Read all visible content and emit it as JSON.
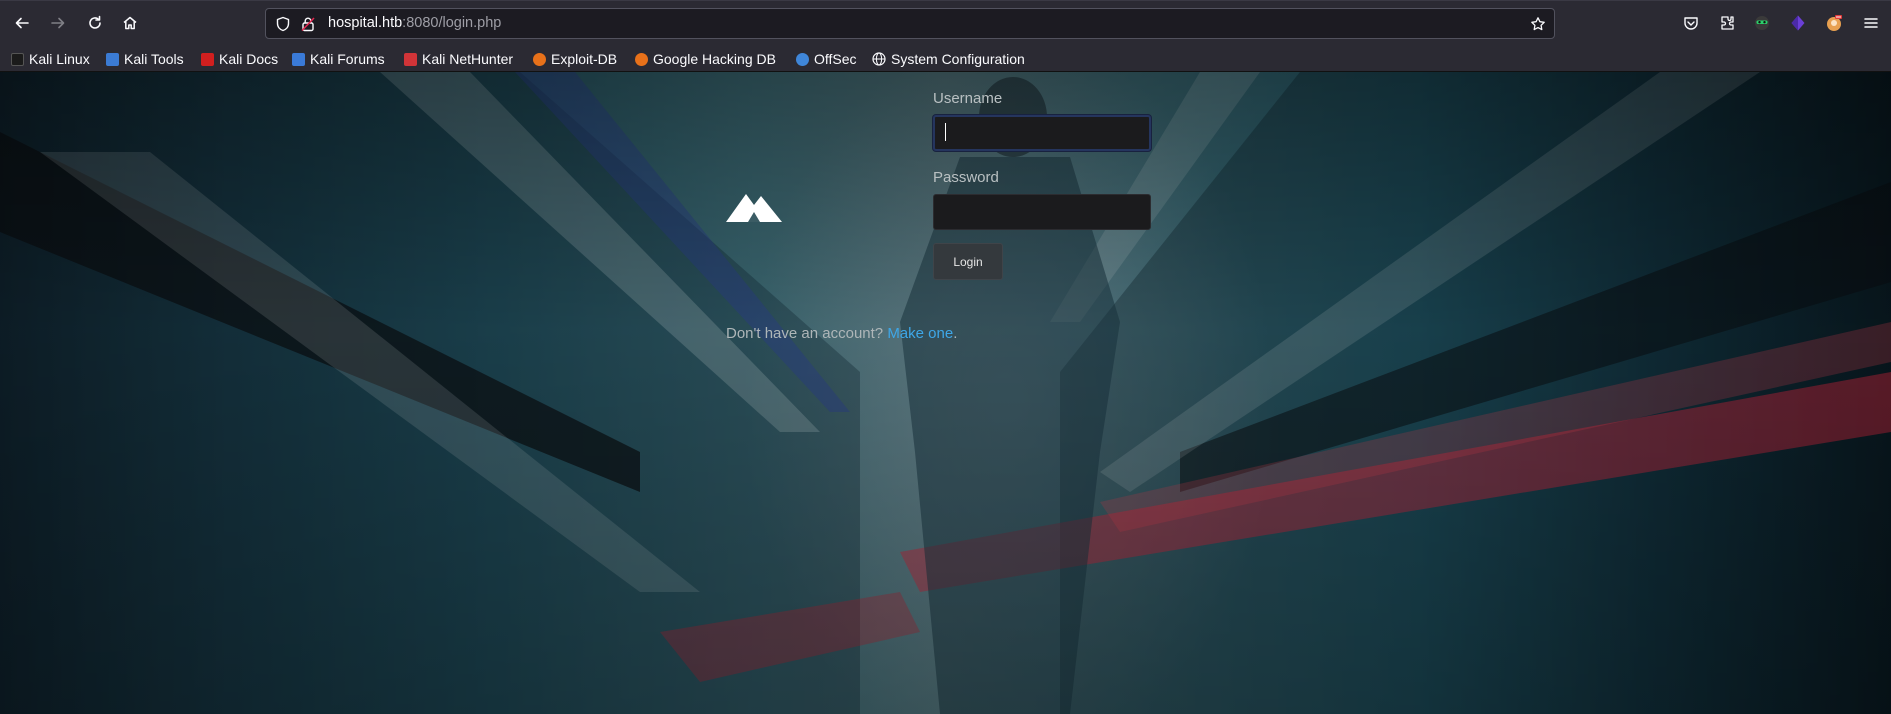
{
  "browser": {
    "url_host": "hospital.htb",
    "url_rest": ":8080/login.php",
    "nav_icons": [
      "back-arrow-icon",
      "forward-arrow-icon",
      "reload-icon",
      "home-icon"
    ],
    "url_icons": [
      "shield-icon",
      "lock-icon",
      "star-icon"
    ],
    "extension_icons": [
      "pocket-icon",
      "extensions-icon",
      "hacker-mask-icon",
      "purple-cube-icon",
      "profile-avatar-icon",
      "hamburger-menu-icon"
    ]
  },
  "bookmarks": [
    {
      "label": "Kali Linux",
      "color": "#1b1b1b"
    },
    {
      "label": "Kali Tools",
      "color": "#3b7bd4"
    },
    {
      "label": "Kali Docs",
      "color": "#d21f1f"
    },
    {
      "label": "Kali Forums",
      "color": "#3a7ad8"
    },
    {
      "label": "Kali NetHunter",
      "color": "#d13438"
    },
    {
      "label": "Exploit-DB",
      "color": "#e8711a"
    },
    {
      "label": "Google Hacking DB",
      "color": "#e8711a"
    },
    {
      "label": "OffSec",
      "color": "#3f86d9"
    },
    {
      "label": "System Configuration",
      "color": "#ffffff"
    }
  ],
  "login": {
    "username_label": "Username",
    "username_value": "",
    "password_label": "Password",
    "password_value": "",
    "login_button": "Login",
    "no_account_text": "Don't have an account? ",
    "make_one_link": "Make one",
    "period": "."
  },
  "colors": {
    "link": "#3ea7e8",
    "chrome_bg": "#2b2a33",
    "input_bg": "#1b1b1d"
  }
}
